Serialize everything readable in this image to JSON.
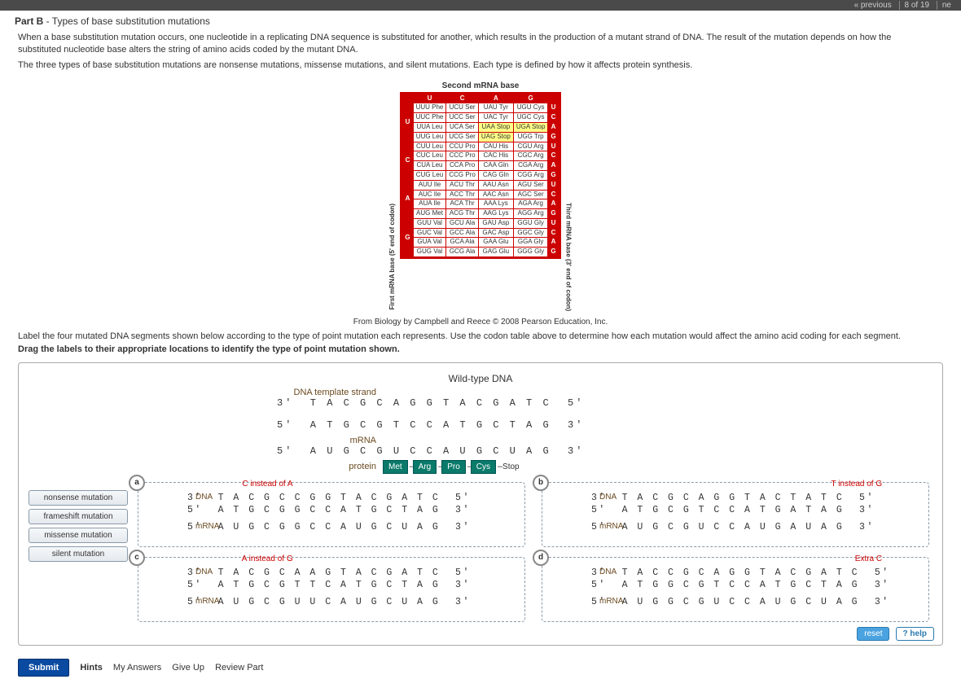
{
  "nav": {
    "prev": "« previous",
    "pager": "8 of 19",
    "next": "ne"
  },
  "header": {
    "part": "Part B",
    "sep": " - ",
    "title": "Types of base substitution mutations"
  },
  "intro": {
    "p1": "When a base substitution mutation occurs, one nucleotide in a replicating DNA sequence is substituted for another, which results in the production of a mutant strand of DNA. The result of the mutation depends on how the substituted nucleotide base alters the string of amino acids coded by the mutant DNA.",
    "p2": "The three types of base substitution mutations are nonsense mutations, missense mutations, and silent mutations. Each type is defined by how it affects protein synthesis."
  },
  "codon": {
    "top": "Second mRNA base",
    "left": "First mRNA base (5' end of codon)",
    "right": "Third mRNA base (3' end of codon)",
    "cols": [
      "U",
      "C",
      "A",
      "G"
    ],
    "rows": [
      {
        "first": "U",
        "cells": [
          [
            "UUU Phe",
            "UCU Ser",
            "UAU Tyr",
            "UGU Cys",
            "U"
          ],
          [
            "UUC Phe",
            "UCC Ser",
            "UAC Tyr",
            "UGC Cys",
            "C"
          ],
          [
            "UUA Leu",
            "UCA Ser",
            "UAA Stop",
            "UGA Stop",
            "A"
          ],
          [
            "UUG Leu",
            "UCG Ser",
            "UAG Stop",
            "UGG Trp",
            "G"
          ]
        ]
      },
      {
        "first": "C",
        "cells": [
          [
            "CUU Leu",
            "CCU Pro",
            "CAU His",
            "CGU Arg",
            "U"
          ],
          [
            "CUC Leu",
            "CCC Pro",
            "CAC His",
            "CGC Arg",
            "C"
          ],
          [
            "CUA Leu",
            "CCA Pro",
            "CAA Gln",
            "CGA Arg",
            "A"
          ],
          [
            "CUG Leu",
            "CCG Pro",
            "CAG Gln",
            "CGG Arg",
            "G"
          ]
        ]
      },
      {
        "first": "A",
        "cells": [
          [
            "AUU Ile",
            "ACU Thr",
            "AAU Asn",
            "AGU Ser",
            "U"
          ],
          [
            "AUC Ile",
            "ACC Thr",
            "AAC Asn",
            "AGC Ser",
            "C"
          ],
          [
            "AUA Ile",
            "ACA Thr",
            "AAA Lys",
            "AGA Arg",
            "A"
          ],
          [
            "AUG Met",
            "ACG Thr",
            "AAG Lys",
            "AGG Arg",
            "G"
          ]
        ]
      },
      {
        "first": "G",
        "cells": [
          [
            "GUU Val",
            "GCU Ala",
            "GAU Asp",
            "GGU Gly",
            "U"
          ],
          [
            "GUC Val",
            "GCC Ala",
            "GAC Asp",
            "GGC Gly",
            "C"
          ],
          [
            "GUA Val",
            "GCA Ala",
            "GAA Glu",
            "GGA Gly",
            "A"
          ],
          [
            "GUG Val",
            "GCG Ala",
            "GAG Glu",
            "GGG Gly",
            "G"
          ]
        ]
      }
    ]
  },
  "citation": "From Biology by Campbell and Reece © 2008 Pearson Education, Inc.",
  "task": {
    "line1": "Label the four mutated DNA segments shown below according to the type of point mutation each represents. Use the codon table above to determine how each mutation would affect the amino acid coding for each segment.",
    "line2": "Drag the labels to their appropriate locations to identify the type of point mutation shown."
  },
  "wild": {
    "title": "Wild-type DNA",
    "lbl_template": "DNA template strand",
    "seq_top": "3'  T A C G C A G G T A C G A T C  5'",
    "seq_bot": "5'  A T G C G T C C A T G C T A G  3'",
    "lbl_mrna": "mRNA",
    "seq_mrna": "5'  A U G C G U C C A U G C U A G  3'",
    "lbl_protein": "protein",
    "aa": [
      "Met",
      "Arg",
      "Pro",
      "Cys",
      "Stop"
    ]
  },
  "labels": [
    "nonsense mutation",
    "frameshift mutation",
    "missense mutation",
    "silent mutation"
  ],
  "panels": {
    "a": {
      "badge": "a",
      "note": "C instead of A",
      "note_side": "left",
      "dna_lbl": "DNA",
      "mrna_lbl": "mRNA",
      "dna1": "3'  T A C G C C G G T A C G A T C  5'",
      "dna2": "5'  A T G C G G C C A T G C T A G  3'",
      "mrna": "5'  A U G C G G C C A U G C U A G  3'"
    },
    "b": {
      "badge": "b",
      "note": "T instead of G",
      "note_side": "right",
      "dna_lbl": "DNA",
      "mrna_lbl": "mRNA",
      "dna1": "3'  T A C G C A G G T A C T A T C  5'",
      "dna2": "5'  A T G C G T C C A T G A T A G  3'",
      "mrna": "5'  A U G C G U C C A U G A U A G  3'"
    },
    "c": {
      "badge": "c",
      "note": "A instead of G",
      "note_side": "left",
      "dna_lbl": "DNA",
      "mrna_lbl": "mRNA",
      "dna1": "3'  T A C G C A A G T A C G A T C  5'",
      "dna2": "5'  A T G C G T T C A T G C T A G  3'",
      "mrna": "5'  A U G C G U U C A U G C U A G  3'"
    },
    "d": {
      "badge": "d",
      "note": "Extra C",
      "note_side": "right",
      "dna_lbl": "DNA",
      "mrna_lbl": "mRNA",
      "dna1": "3'  T A C C G C A G G T A C G A T C  5'",
      "dna2": "5'  A T G G C G T C C A T G C T A G  3'",
      "mrna": "5'  A U G G C G U C C A U G C U A G  3'"
    }
  },
  "controls": {
    "reset": "reset",
    "help": "? help"
  },
  "bottom": {
    "submit": "Submit",
    "hints": "Hints",
    "myans": "My Answers",
    "giveup": "Give Up",
    "review": "Review Part"
  }
}
